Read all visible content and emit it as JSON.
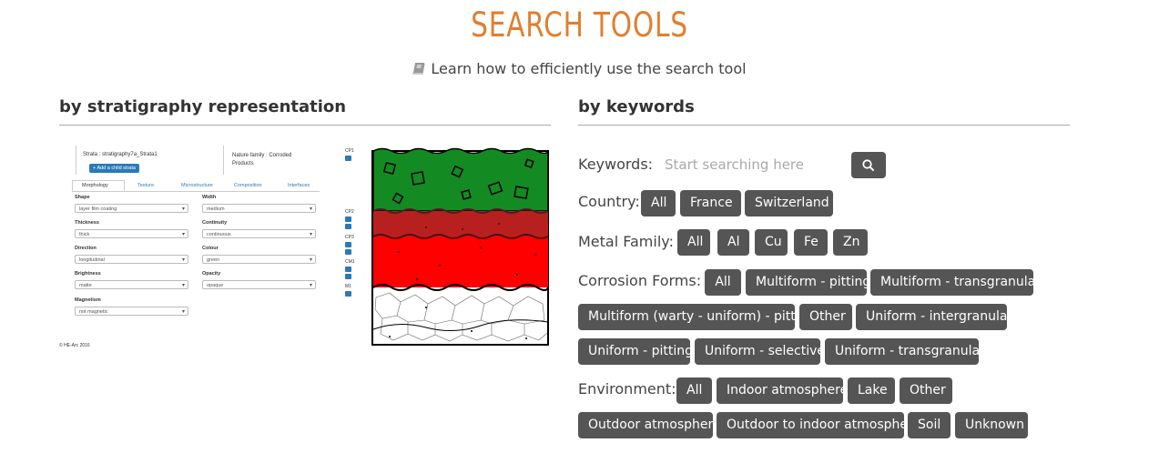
{
  "title": "SEARCH TOOLS",
  "help_link": "Learn how to efficiently use the search tool",
  "sections": {
    "left": "by stratigraphy representation",
    "right": "by keywords"
  },
  "strata_form": {
    "strata_name": "Strata : stratigraphy7a_Strata1",
    "add_child": "Add a child strata",
    "nature_family": "Nature family : Corroded Products",
    "tabs": [
      "Morphology",
      "Texture",
      "Microstructure",
      "Composition",
      "Interfaces"
    ],
    "fields": [
      {
        "label": "Shape",
        "value": "layer film coating"
      },
      {
        "label": "Width",
        "value": "medium"
      },
      {
        "label": "Thickness",
        "value": "thick"
      },
      {
        "label": "Continuity",
        "value": "continuous"
      },
      {
        "label": "Direction",
        "value": "longitudinal"
      },
      {
        "label": "Colour",
        "value": "green"
      },
      {
        "label": "Brightness",
        "value": "matte"
      },
      {
        "label": "Opacity",
        "value": "opaque"
      },
      {
        "label": "Magnetism",
        "value": "not magnetic"
      }
    ],
    "copyright": "© HE-Arc 2016",
    "layer_labels": [
      "CP1",
      "CP2",
      "CP3",
      "CM1",
      "M1"
    ],
    "layer_colors": [
      "#148a23",
      "#b82020",
      "#ff0000",
      "#ffffff"
    ]
  },
  "keywords": {
    "label": "Keywords:",
    "placeholder": "Start searching here",
    "search_icon": "search-icon"
  },
  "filters": {
    "country": {
      "label": "Country:",
      "tags": [
        "All",
        "France",
        "Switzerland"
      ]
    },
    "metal": {
      "label": "Metal Family:",
      "tags": [
        "All",
        "Al",
        "Cu",
        "Fe",
        "Zn"
      ]
    },
    "corrosion": {
      "label": "Corrosion Forms:",
      "tags": [
        "All",
        "Multiform - pitting",
        "Multiform - transgranular",
        "Multiform (warty - uniform) - pitting",
        "Other",
        "Uniform - intergranular",
        "Uniform - pitting",
        "Uniform - selective",
        "Uniform - transgranular"
      ]
    },
    "environment": {
      "label": "Environment:",
      "tags": [
        "All",
        "Indoor atmosphere",
        "Lake",
        "Other",
        "Outdoor atmosphere",
        "Outdoor to indoor atmosphere",
        "Soil",
        "Unknown"
      ]
    }
  }
}
